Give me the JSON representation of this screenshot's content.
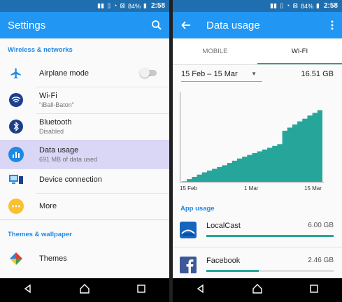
{
  "status": {
    "battery": "84%",
    "time": "2:58"
  },
  "settings": {
    "title": "Settings",
    "sections": [
      {
        "label": "Wireless & networks"
      },
      {
        "label": "Themes & wallpaper"
      }
    ],
    "items": [
      {
        "title": "Airplane mode",
        "subtitle": ""
      },
      {
        "title": "Wi-Fi",
        "subtitle": "\"iBall-Baton\""
      },
      {
        "title": "Bluetooth",
        "subtitle": "Disabled"
      },
      {
        "title": "Data usage",
        "subtitle": "691 MB of data used"
      },
      {
        "title": "Device connection",
        "subtitle": ""
      },
      {
        "title": "More",
        "subtitle": ""
      },
      {
        "title": "Themes",
        "subtitle": ""
      }
    ],
    "airplane_on": false
  },
  "data_usage": {
    "title": "Data usage",
    "tabs": [
      {
        "label": "MOBILE"
      },
      {
        "label": "WI-FI"
      }
    ],
    "active_tab": 1,
    "range": "15 Feb – 15 Mar",
    "total": "16.51 GB",
    "app_usage_label": "App usage",
    "apps": [
      {
        "name": "LocalCast",
        "size": "6.00 GB",
        "fraction": 1.0
      },
      {
        "name": "Facebook",
        "size": "2.46 GB",
        "fraction": 0.41
      }
    ]
  },
  "chart_data": {
    "type": "area",
    "x_tick_labels": [
      "15 Feb",
      "1 Mar",
      "15 Mar"
    ],
    "x_days": [
      0,
      1,
      2,
      3,
      4,
      5,
      6,
      7,
      8,
      9,
      10,
      11,
      12,
      13,
      14,
      15,
      16,
      17,
      18,
      19,
      20,
      21,
      22,
      23,
      24,
      25,
      26,
      27,
      28
    ],
    "y_gb": [
      0.1,
      0.6,
      1.1,
      1.6,
      2.1,
      2.5,
      2.9,
      3.3,
      3.7,
      4.2,
      4.7,
      5.2,
      5.6,
      6.0,
      6.4,
      6.8,
      7.2,
      7.6,
      8.0,
      8.4,
      11.4,
      12.1,
      12.8,
      13.5,
      14.1,
      14.8,
      15.4,
      16.0,
      16.51
    ],
    "ylim": [
      0,
      20
    ],
    "grid": false,
    "color": "#26a69a"
  }
}
